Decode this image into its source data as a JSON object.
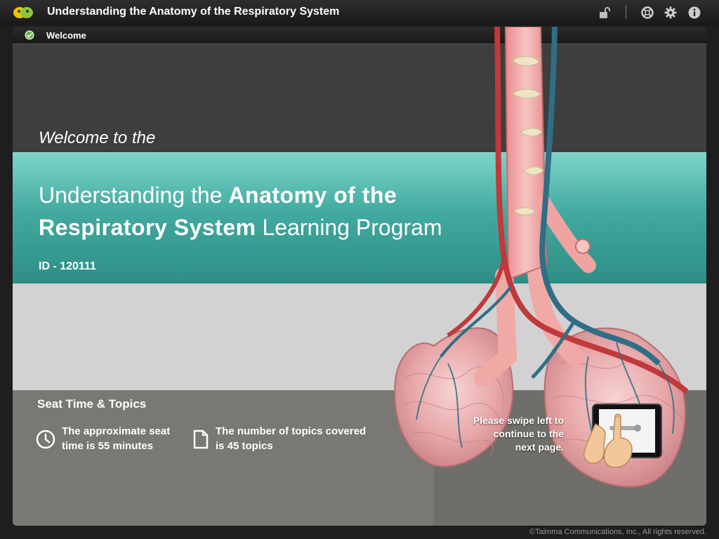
{
  "app": {
    "title": "Understanding the Anatomy of the Respiratory System"
  },
  "toolbar_icons": [
    "lock-open-icon",
    "lifebuoy-icon",
    "gear-icon",
    "info-icon"
  ],
  "tab": {
    "label": "Welcome"
  },
  "hero": {
    "welcome": "Welcome to the",
    "title_line1_regular": "Understanding the ",
    "title_line1_bold": "Anatomy of the",
    "title_line2_bold": "Respiratory System",
    "title_line2_regular": " Learning Program",
    "id": "ID - 120111"
  },
  "seat": {
    "heading": "Seat Time & Topics",
    "time_line1": "The approximate seat",
    "time_line2": "time is 55 minutes",
    "topics_line1": "The number of topics covered",
    "topics_line2": "is 45 topics"
  },
  "swipe": {
    "line1": "Please swipe left to",
    "line2": "continue to the",
    "line3": "next page."
  },
  "footer": {
    "copyright": "©Taimma Communications, Inc., All rights reserved."
  },
  "colors": {
    "teal": "#42aaa0",
    "artery_red": "#c0393b",
    "vein_blue": "#2f6e86",
    "trachea_pink": "#f1a9a6"
  }
}
